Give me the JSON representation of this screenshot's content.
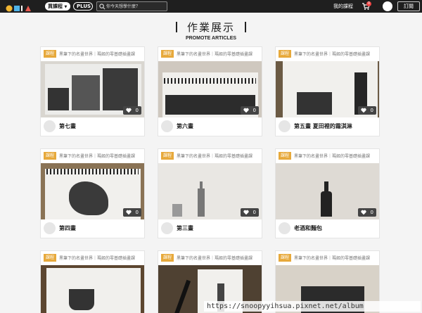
{
  "topbar": {
    "logo_text": "OMIA",
    "buy_course_label": "買課程",
    "plus_label": "PLUS",
    "search": {
      "placeholder": "你今天想學什麼？",
      "icon": "search-icon"
    },
    "my_courses_label": "我的課程",
    "cart": {
      "icon": "cart-icon",
      "badge": "0"
    },
    "subscribe_label": "訂閱"
  },
  "heading": {
    "title": "作業展示",
    "subtitle": "PROMOTE ARTICLES"
  },
  "cards": [
    {
      "tag": "課程",
      "course": "黑筆下的名畫世界｜瑪姬的零基礎插畫課",
      "likes": "0",
      "title": "第七畫"
    },
    {
      "tag": "課程",
      "course": "黑筆下的名畫世界｜瑪姬的零基礎插畫課",
      "likes": "0",
      "title": "第六畫"
    },
    {
      "tag": "課程",
      "course": "黑筆下的名畫世界｜瑪姬的零基礎插畫課",
      "likes": "0",
      "title": "第五畫 夏田裡的霜淇淋"
    },
    {
      "tag": "課程",
      "course": "黑筆下的名畫世界｜瑪姬的零基礎插畫課",
      "likes": "0",
      "title": "第四畫"
    },
    {
      "tag": "課程",
      "course": "黑筆下的名畫世界｜瑪姬的零基礎插畫課",
      "likes": "0",
      "title": "第三畫"
    },
    {
      "tag": "課程",
      "course": "黑筆下的名畫世界｜瑪姬的零基礎插畫課",
      "likes": "0",
      "title": "老酒和麵包"
    },
    {
      "tag": "課程",
      "course": "黑筆下的名畫世界｜瑪姬的零基礎插畫課",
      "likes": "",
      "title": ""
    },
    {
      "tag": "課程",
      "course": "黑筆下的名畫世界｜瑪姬的零基礎插畫課",
      "likes": "",
      "title": ""
    },
    {
      "tag": "課程",
      "course": "黑筆下的名畫世界｜瑪姬的零基礎插畫課",
      "likes": "",
      "title": ""
    }
  ],
  "watermark": "https://snoopyyihsua.pixnet.net/album",
  "colors": {
    "topbar": "#1f1f1f",
    "tag": "#e7a93b",
    "page_bg": "#f4f4f4"
  }
}
